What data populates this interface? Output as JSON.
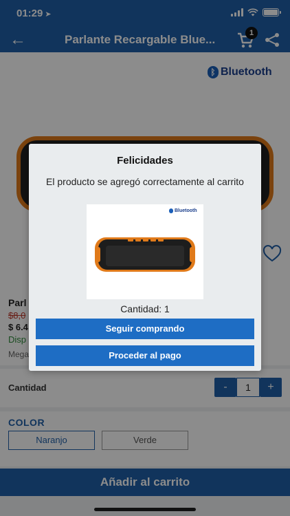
{
  "status_bar": {
    "time": "01:29"
  },
  "nav": {
    "title": "Parlante Recargable Blue...",
    "cart_count": "1"
  },
  "product": {
    "brand_logo": "Bluetooth",
    "name_partial": "Parl",
    "old_price_partial": "$8,0",
    "price_partial": "$ 6.4",
    "availability_partial": "Disp",
    "seller_partial": "Mega"
  },
  "quantity": {
    "label": "Cantidad",
    "minus": "-",
    "value": "1",
    "plus": "+"
  },
  "color": {
    "title": "COLOR",
    "options": [
      "Naranjo",
      "Verde"
    ],
    "selected": "Naranjo"
  },
  "add_to_cart": "Añadir al carrito",
  "modal": {
    "title": "Felicidades",
    "message": "El producto se agregó correctamente al carrito",
    "image_logo": "Bluetooth",
    "quantity_text": "Cantidad: 1",
    "continue_label": "Seguir comprando",
    "checkout_label": "Proceder al pago"
  },
  "colors": {
    "primary": "#1f5fa8",
    "button": "#1e6dc4",
    "speaker_accent": "#e07a1a"
  }
}
